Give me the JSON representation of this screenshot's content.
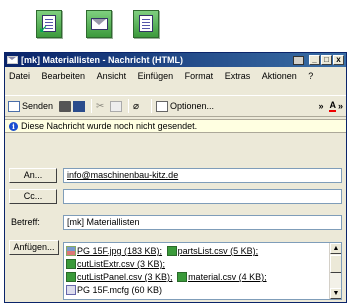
{
  "launcher": {
    "icons": [
      "word-doc-icon",
      "mail-icon",
      "excel-doc-icon"
    ]
  },
  "window": {
    "title": "[mk] Materiallisten - Nachricht (HTML)",
    "controls": [
      "_",
      "□",
      "x"
    ]
  },
  "menu": {
    "items": [
      "Datei",
      "Bearbeiten",
      "Ansicht",
      "Einfügen",
      "Format",
      "Extras",
      "Aktionen",
      "?"
    ]
  },
  "toolbar": {
    "send_label": "Senden",
    "options_label": "Optionen...",
    "overflow": "»"
  },
  "info": {
    "message": "Diese Nachricht wurde noch nicht gesendet."
  },
  "fields": {
    "to_label": "An...",
    "to_value": "info@maschinenbau-kitz.de",
    "cc_label": "Cc...",
    "cc_value": "",
    "subject_label": "Betreff:",
    "subject_value": "[mk] Materiallisten",
    "attach_label": "Anfügen..."
  },
  "attachments": [
    {
      "name": "PG 15F.jpg (183 KB);",
      "type": "image"
    },
    {
      "name": "partsList.csv (5 KB);",
      "type": "csv"
    },
    {
      "name": "cutListExtr.csv (3 KB);",
      "type": "csv"
    },
    {
      "name": "cutListPanel.csv (3 KB);",
      "type": "csv"
    },
    {
      "name": "material.csv (4 KB);",
      "type": "csv"
    },
    {
      "name": "PG 15F.mcfg (60 KB)",
      "type": "mcfg"
    }
  ]
}
